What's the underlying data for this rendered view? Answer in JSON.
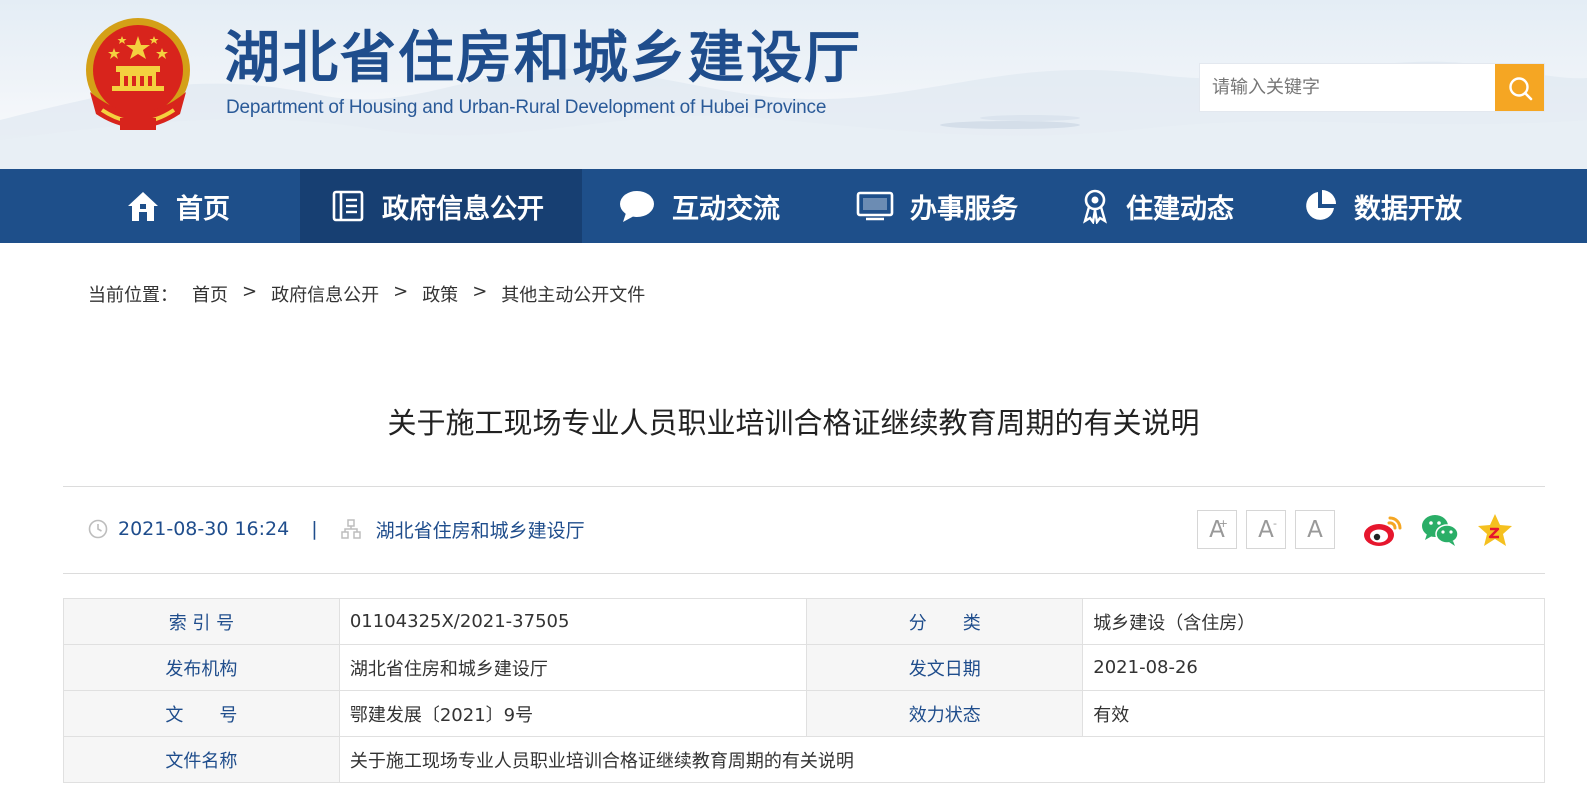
{
  "header": {
    "title": "湖北省住房和城乡建设厅",
    "subtitle": "Department of Housing and Urban-Rural Development of Hubei Province",
    "search_placeholder": "请输入关键字"
  },
  "nav": {
    "items": [
      {
        "label": "首页",
        "icon": "home-icon"
      },
      {
        "label": "政府信息公开",
        "icon": "document-list-icon",
        "active": true
      },
      {
        "label": "互动交流",
        "icon": "chat-bubble-icon"
      },
      {
        "label": "办事服务",
        "icon": "monitor-icon"
      },
      {
        "label": "住建动态",
        "icon": "award-ribbon-icon"
      },
      {
        "label": "数据开放",
        "icon": "pie-chart-icon"
      }
    ]
  },
  "breadcrumb": {
    "prefix": "当前位置：",
    "items": [
      "首页",
      "政府信息公开",
      "政策",
      "其他主动公开文件"
    ],
    "separator": ">"
  },
  "article": {
    "title": "关于施工现场专业人员职业培训合格证继续教育周期的有关说明",
    "datetime": "2021-08-30 16:24",
    "divider": "|",
    "publisher": "湖北省住房和城乡建设厅"
  },
  "font_tools": {
    "increase": "A",
    "increase_mark": "+",
    "decrease": "A",
    "decrease_mark": "-",
    "reset": "A"
  },
  "share_icons": [
    "weibo-icon",
    "wechat-icon",
    "favorite-star-icon"
  ],
  "info_table": {
    "rows": [
      {
        "k1": "索 引 号",
        "v1": "01104325X/2021-37505",
        "k2": "分　　类",
        "v2": "城乡建设（含住房）"
      },
      {
        "k1": "发布机构",
        "v1": "湖北省住房和城乡建设厅",
        "k2": "发文日期",
        "v2": "2021-08-26"
      },
      {
        "k1": "文　　号",
        "v1": "鄂建发展〔2021〕9号",
        "k2": "效力状态",
        "v2": "有效"
      }
    ],
    "file_name_label": "文件名称",
    "file_name": "关于施工现场专业人员职业培训合格证继续教育周期的有关说明"
  },
  "colors": {
    "brand_blue": "#1e4f8a",
    "nav_active": "#173f72",
    "search_button": "#f5a623",
    "title_blue": "#1f4d8c"
  }
}
